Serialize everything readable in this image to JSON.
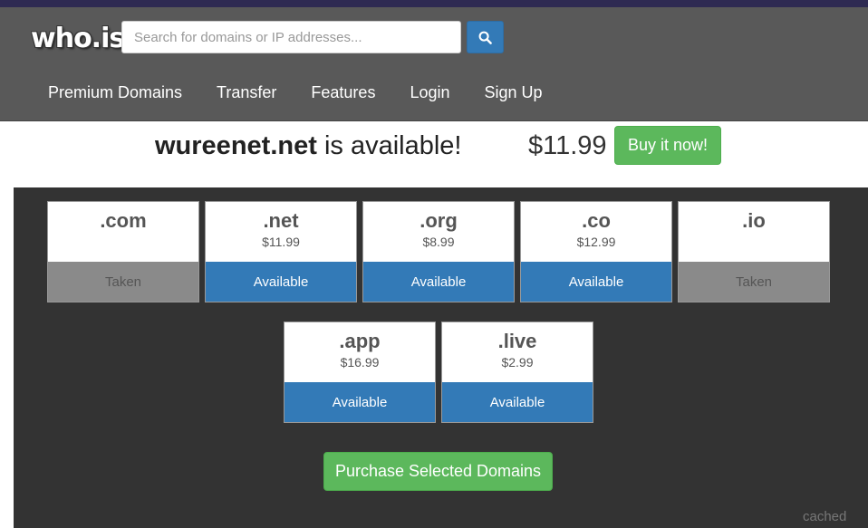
{
  "header": {
    "logo": "who.is",
    "search_placeholder": "Search for domains or IP addresses...",
    "nav": [
      "Premium Domains",
      "Transfer",
      "Features",
      "Login",
      "Sign Up"
    ]
  },
  "result": {
    "domain": "wureenet.net",
    "message": "is available!",
    "price": "$11.99",
    "buy_label": "Buy it now!"
  },
  "tlds": [
    {
      "tld": ".com",
      "price": "",
      "status": "Taken"
    },
    {
      "tld": ".net",
      "price": "$11.99",
      "status": "Available"
    },
    {
      "tld": ".org",
      "price": "$8.99",
      "status": "Available"
    },
    {
      "tld": ".co",
      "price": "$12.99",
      "status": "Available"
    },
    {
      "tld": ".io",
      "price": "",
      "status": "Taken"
    },
    {
      "tld": ".app",
      "price": "$16.99",
      "status": "Available"
    },
    {
      "tld": ".live",
      "price": "$2.99",
      "status": "Available"
    }
  ],
  "purchase_label": "Purchase Selected Domains",
  "cached_label": "cached",
  "colors": {
    "available": "#337ab7",
    "taken": "#8a8a8a",
    "buy": "#5cb85c",
    "header": "#595959"
  }
}
